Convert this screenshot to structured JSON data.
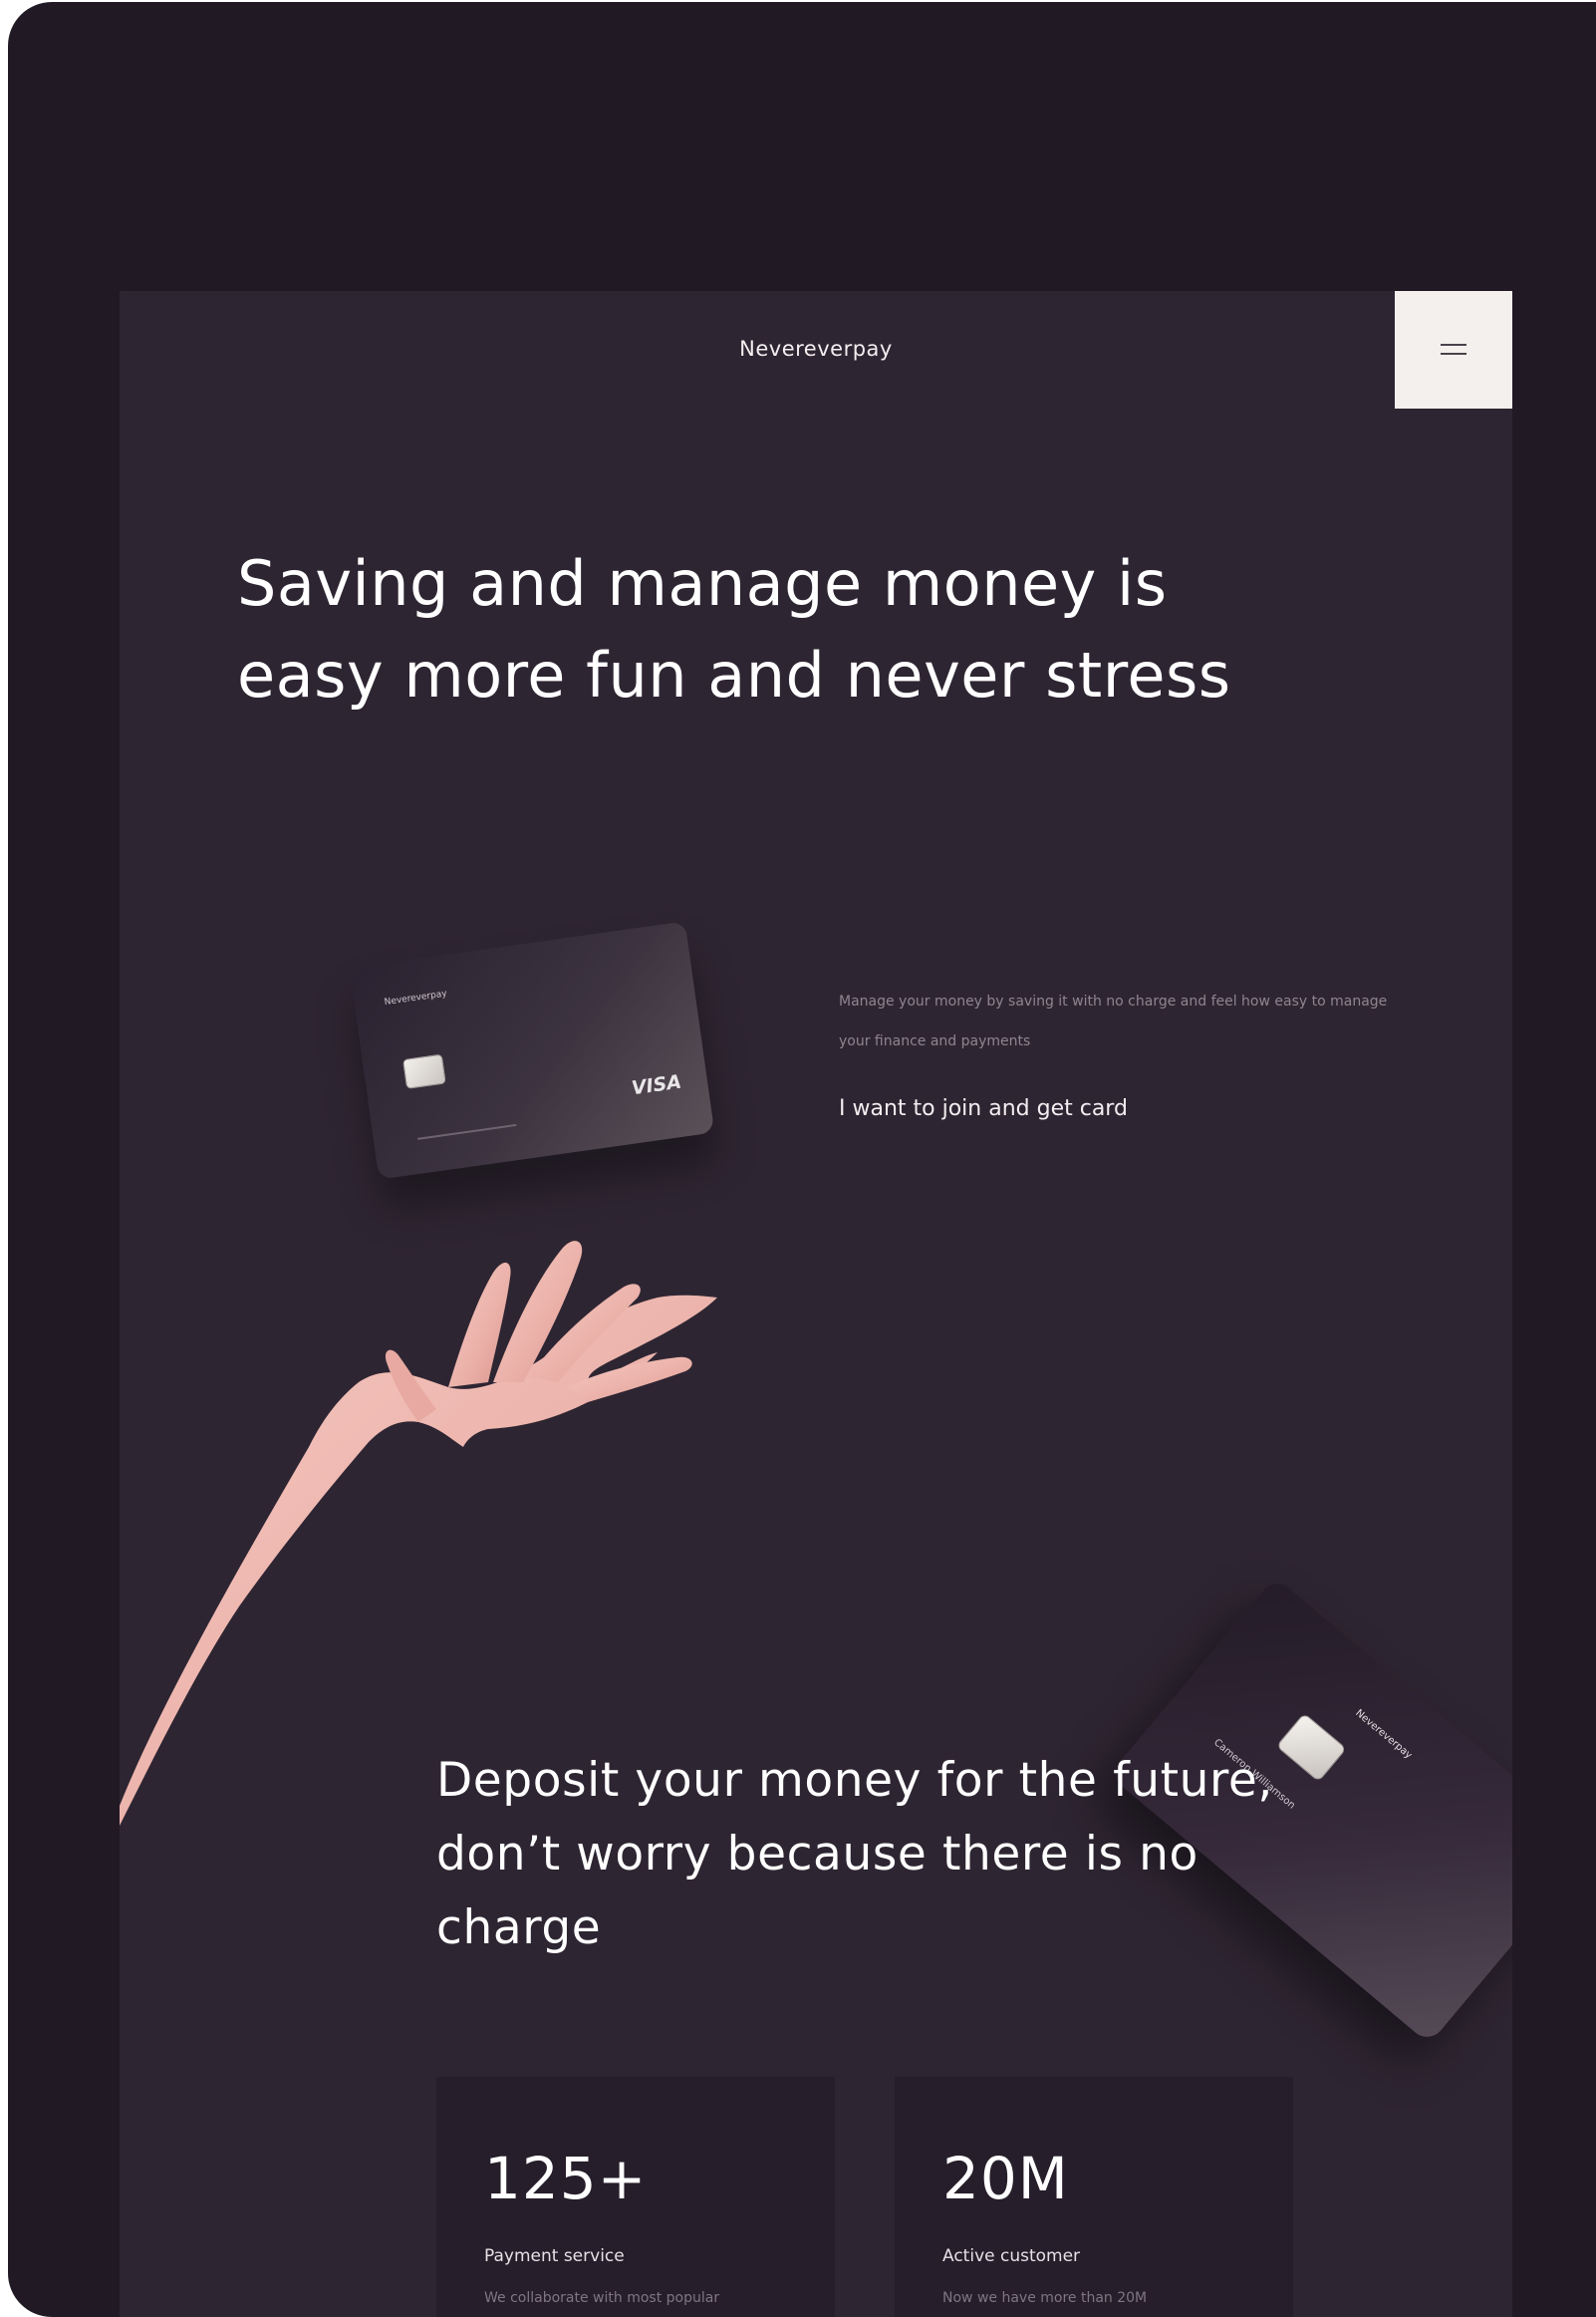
{
  "header": {
    "brand": "Nevereverpay",
    "menu_icon": "hamburger-menu-icon"
  },
  "hero": {
    "title": "Saving and manage money is easy more fun and never stress",
    "blurb": "Manage your money by saving it with no charge and feel how easy to manage your finance and payments",
    "cta": "I want to join and get card"
  },
  "card_front": {
    "brand": "Nevereverpay",
    "network": "VISA"
  },
  "card_back": {
    "brand": "Nevereverpay",
    "holder": "Cameron Williamson"
  },
  "deposit": {
    "title": "Deposit your money for the future, don’t worry because there is no charge"
  },
  "stats": [
    {
      "number": "125+",
      "label": "Payment service",
      "desc": "We collaborate with most popular"
    },
    {
      "number": "20M",
      "label": "Active customer",
      "desc": "Now we have more than 20M"
    }
  ],
  "colors": {
    "outer_bg": "#211a24",
    "site_bg": "#2e2532",
    "menu_button_bg": "#f4f0ed",
    "stat_card_bg": "#261e2a",
    "muted_text": "#8d8590"
  }
}
